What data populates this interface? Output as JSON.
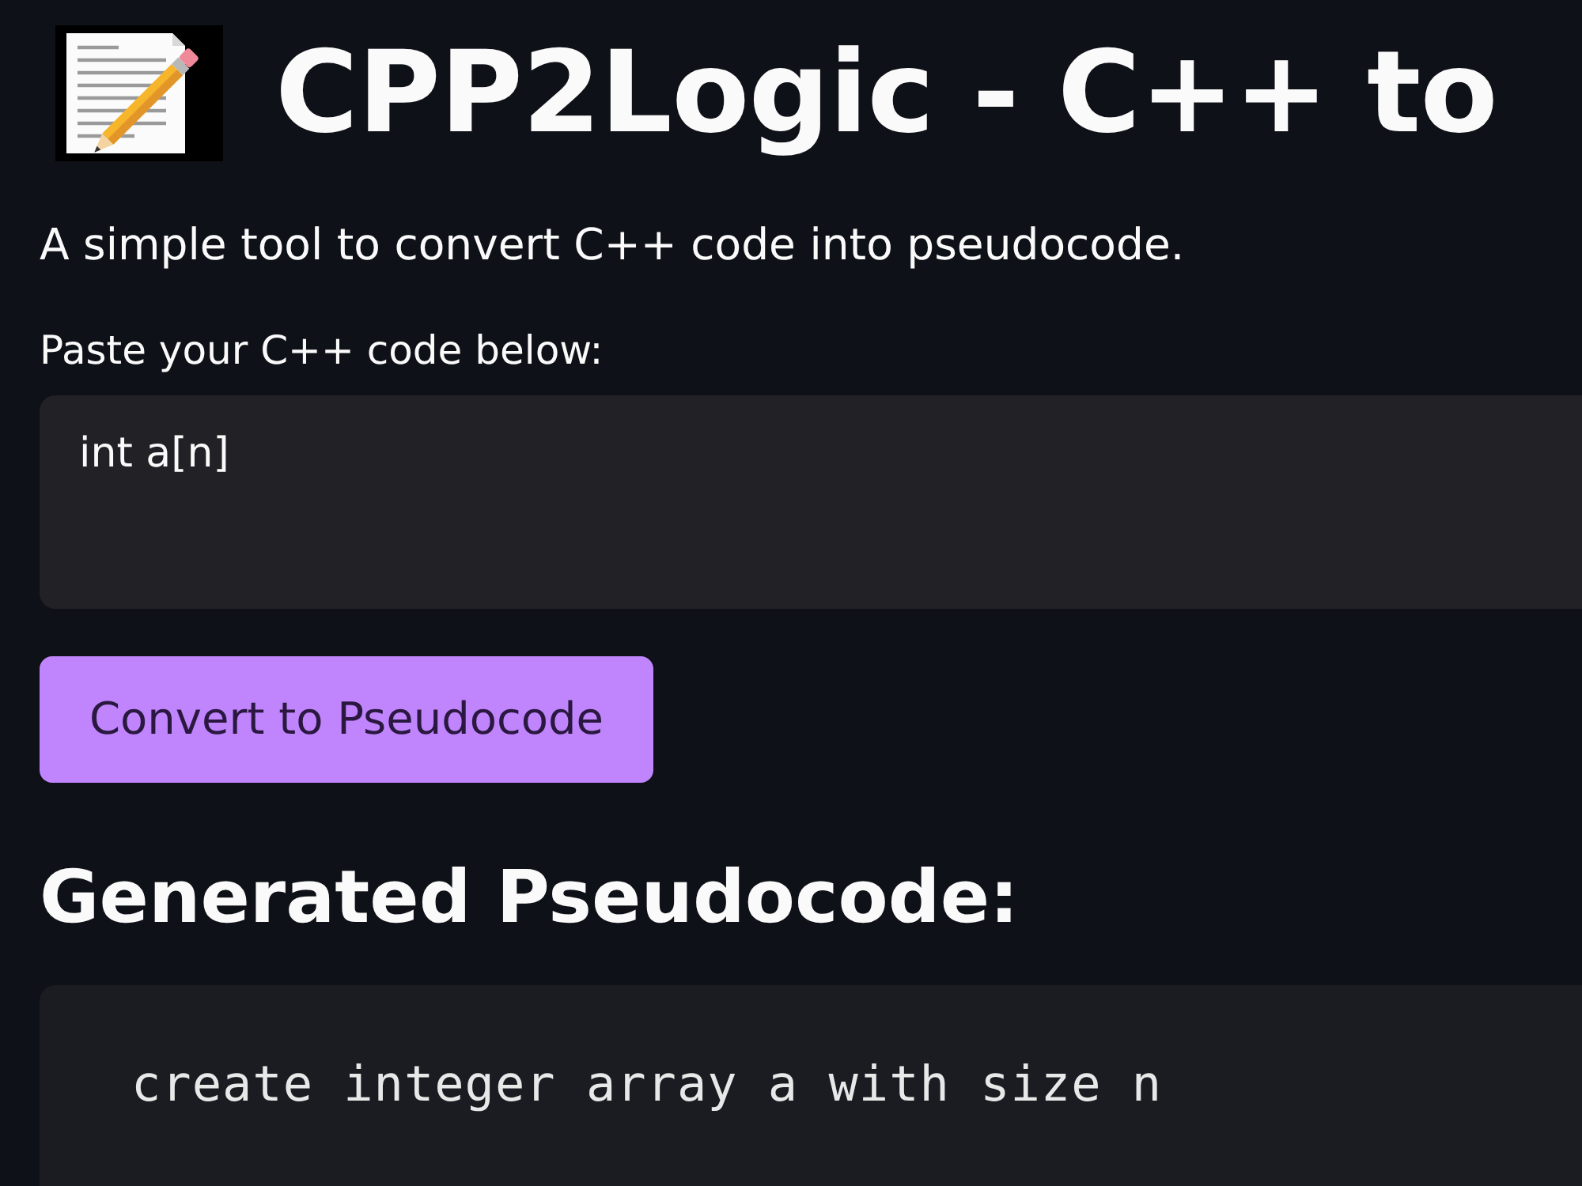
{
  "header": {
    "title": "CPP2Logic - C++ to"
  },
  "description": "A simple tool to convert C++ code into pseudocode.",
  "input": {
    "label": "Paste your C++ code below:",
    "value": "int a[n]"
  },
  "convert_button": {
    "label": "Convert to Pseudocode"
  },
  "output": {
    "heading": "Generated Pseudocode:",
    "code": "create integer array a with size n"
  }
}
